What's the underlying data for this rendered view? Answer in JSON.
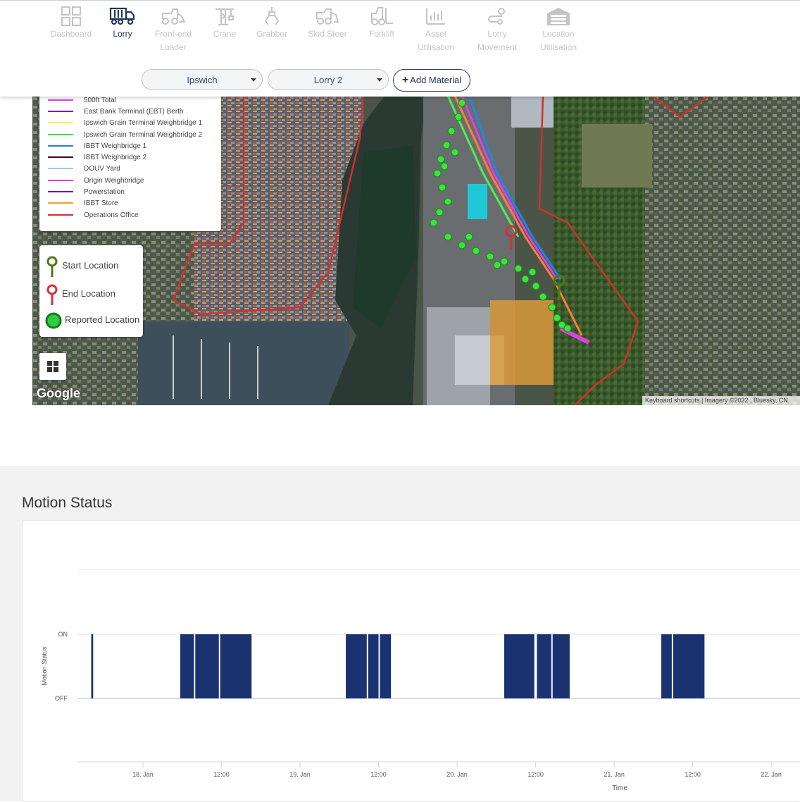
{
  "nav": {
    "items": [
      {
        "label": "Dashboard",
        "icon": "dashboard-grid-icon",
        "active": false
      },
      {
        "label": "Lorry",
        "icon": "lorry-icon",
        "active": true
      },
      {
        "label": "Front-end Loader",
        "icon": "loader-icon",
        "active": false
      },
      {
        "label": "Crane",
        "icon": "crane-icon",
        "active": false
      },
      {
        "label": "Grabber",
        "icon": "grabber-icon",
        "active": false
      },
      {
        "label": "Skid Steer",
        "icon": "skid-steer-icon",
        "active": false
      },
      {
        "label": "Forklift",
        "icon": "forklift-icon",
        "active": false
      },
      {
        "label": "Asset Utilisation",
        "icon": "bar-chart-icon",
        "active": false
      },
      {
        "label": "Lorry Movement",
        "icon": "route-icon",
        "active": false
      },
      {
        "label": "Location Utilisation",
        "icon": "warehouse-icon",
        "active": false
      }
    ]
  },
  "filters": {
    "site": "Ipswich",
    "vehicle": "Lorry 2",
    "add_material_label": "Add Material"
  },
  "map": {
    "legend": [
      {
        "label": "500ft Total",
        "color": "#e040e0"
      },
      {
        "label": "East Bank Terminal (EBT) Berth",
        "color": "#7a1fa2"
      },
      {
        "label": "Ipswich Grain Terminal Weighbridge 1",
        "color": "#f5f542"
      },
      {
        "label": "Ipswich Grain Terminal Weighbridge 2",
        "color": "#3fe03f"
      },
      {
        "label": "IBBT Weighbridge 1",
        "color": "#2b7fc2"
      },
      {
        "label": "IBBT Weighbridge 2",
        "color": "#3a0d0d"
      },
      {
        "label": "DOUV Yard",
        "color": "#9ec8f0"
      },
      {
        "label": "Origin Weighbridge",
        "color": "#e040c8"
      },
      {
        "label": "Powerstation",
        "color": "#6a1b9a"
      },
      {
        "label": "IBBT Store",
        "color": "#f0a030"
      },
      {
        "label": "Operations Office",
        "color": "#d32f2f"
      }
    ],
    "markers": {
      "start_label": "Start Location",
      "end_label": "End Location",
      "reported_label": "Reported Location",
      "start_color": "#4a7a1a",
      "end_color": "#d32f3a",
      "reported_color": "#2ecc40"
    },
    "google_label": "Google",
    "attribution": "Keyboard shortcuts | Imagery ©2022 , Bluesky, CN"
  },
  "motion": {
    "title": "Motion Status"
  },
  "chart_data": {
    "type": "area",
    "ylabel": "Motion Status",
    "xlabel": "Time",
    "y_categories": [
      "OFF",
      "ON"
    ],
    "x_ticks": [
      "18. Jan",
      "12:00",
      "19. Jan",
      "12:00",
      "20. Jan",
      "12:00",
      "21. Jan",
      "12:00",
      "22. Jan"
    ],
    "x_tick_hours": [
      0,
      12,
      24,
      36,
      48,
      60,
      72,
      84,
      96
    ],
    "xlim_hours": [
      -10,
      100.5
    ],
    "series_color": "#1a3370",
    "on_intervals_hours": [
      [
        -7.9,
        -7.6
      ],
      [
        5.7,
        7.8
      ],
      [
        8.0,
        11.6
      ],
      [
        11.8,
        16.6
      ],
      [
        31.0,
        34.2
      ],
      [
        34.4,
        36.0
      ],
      [
        36.2,
        37.9
      ],
      [
        55.2,
        59.8
      ],
      [
        60.2,
        62.4
      ],
      [
        62.6,
        65.2
      ],
      [
        79.2,
        80.8
      ],
      [
        81.0,
        85.8
      ]
    ]
  }
}
